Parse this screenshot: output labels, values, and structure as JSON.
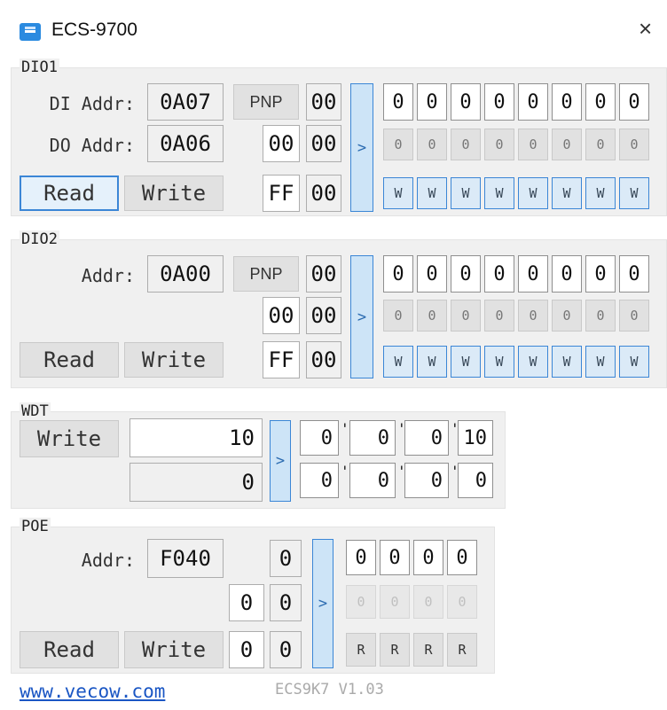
{
  "window": {
    "title": "ECS-9700",
    "close_glyph": "×",
    "icon": "app-icon"
  },
  "dio1": {
    "title": "DIO1",
    "di_label": "DI Addr:",
    "di_addr": "0A07",
    "pnp": "PNP",
    "di_value": "00",
    "do_label": "DO Addr:",
    "do_addr": "0A06",
    "do_val1": "00",
    "do_val2": "00",
    "mask_val1": "FF",
    "mask_val2": "00",
    "arrow": ">",
    "read": "Read",
    "write": "Write",
    "bits_in": [
      "0",
      "0",
      "0",
      "0",
      "0",
      "0",
      "0",
      "0"
    ],
    "bits_out": [
      "0",
      "0",
      "0",
      "0",
      "0",
      "0",
      "0",
      "0"
    ],
    "bits_w": [
      "W",
      "W",
      "W",
      "W",
      "W",
      "W",
      "W",
      "W"
    ]
  },
  "dio2": {
    "title": "DIO2",
    "addr_label": "Addr:",
    "addr": "0A00",
    "pnp": "PNP",
    "di_value": "00",
    "do_val1": "00",
    "do_val2": "00",
    "mask_val1": "FF",
    "mask_val2": "00",
    "arrow": ">",
    "read": "Read",
    "write": "Write",
    "bits_in": [
      "0",
      "0",
      "0",
      "0",
      "0",
      "0",
      "0",
      "0"
    ],
    "bits_out": [
      "0",
      "0",
      "0",
      "0",
      "0",
      "0",
      "0",
      "0"
    ],
    "bits_w": [
      "W",
      "W",
      "W",
      "W",
      "W",
      "W",
      "W",
      "W"
    ]
  },
  "wdt": {
    "title": "WDT",
    "write": "Write",
    "input_top": "10",
    "input_bottom": "0",
    "arrow": ">",
    "row1": [
      "0",
      "0",
      "0",
      "10"
    ],
    "row2": [
      "0",
      "0",
      "0",
      "0"
    ],
    "tick": "'"
  },
  "poe": {
    "title": "POE",
    "addr_label": "Addr:",
    "addr": "F040",
    "val_top": "0",
    "val_mid1": "0",
    "val_mid2": "0",
    "val_bot1": "0",
    "val_bot2": "0",
    "arrow": ">",
    "read": "Read",
    "write": "Write",
    "bits_in": [
      "0",
      "0",
      "0",
      "0"
    ],
    "bits_out": [
      "0",
      "0",
      "0",
      "0"
    ],
    "bits_r": [
      "R",
      "R",
      "R",
      "R"
    ]
  },
  "footer": {
    "link": "www.vecow.com",
    "version": "ECS9K7 V1.03"
  }
}
